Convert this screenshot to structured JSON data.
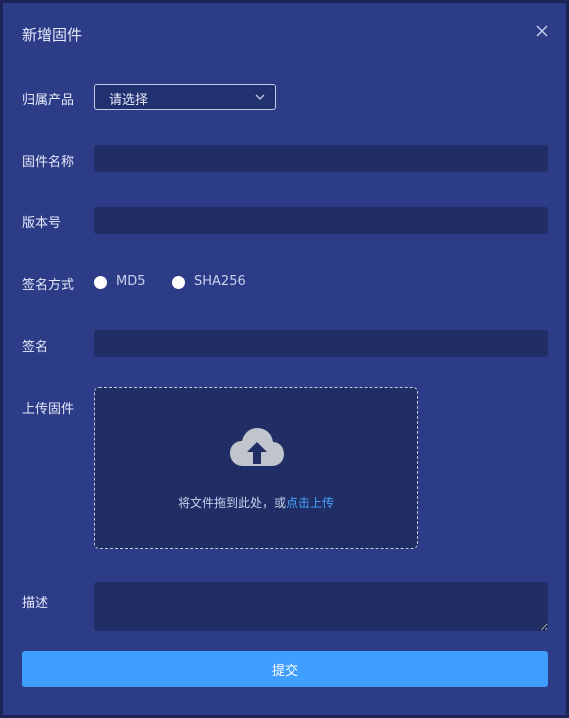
{
  "dialog": {
    "title": "新增固件",
    "close_icon": "close-icon"
  },
  "form": {
    "product": {
      "label": "归属产品",
      "placeholder": "请选择"
    },
    "firmware_name": {
      "label": "固件名称",
      "value": ""
    },
    "version": {
      "label": "版本号",
      "value": ""
    },
    "sign_method": {
      "label": "签名方式",
      "options": [
        {
          "label": "MD5",
          "checked": false
        },
        {
          "label": "SHA256",
          "checked": false
        }
      ]
    },
    "signature": {
      "label": "签名",
      "value": ""
    },
    "upload": {
      "label": "上传固件",
      "icon": "cloud-upload-icon",
      "hint": "将文件拖到此处，或",
      "link": "点击上传"
    },
    "description": {
      "label": "描述",
      "value": ""
    }
  },
  "submit_label": "提交",
  "colors": {
    "background": "#2d3c87",
    "input_bg": "#202e65",
    "primary": "#409eff",
    "link": "#4aa3ff"
  }
}
